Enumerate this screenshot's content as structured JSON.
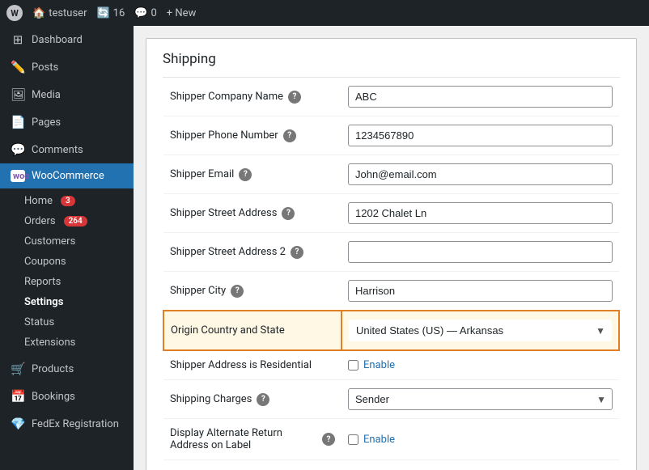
{
  "admin_bar": {
    "wp_logo": "W",
    "home_icon": "🏠",
    "username": "testuser",
    "updates_count": "16",
    "comments_count": "0",
    "new_label": "+ New"
  },
  "sidebar": {
    "dashboard_label": "Dashboard",
    "posts_label": "Posts",
    "media_label": "Media",
    "pages_label": "Pages",
    "comments_label": "Comments",
    "woocommerce_label": "WooCommerce",
    "home_label": "Home",
    "home_badge": "3",
    "orders_label": "Orders",
    "orders_badge": "264",
    "customers_label": "Customers",
    "coupons_label": "Coupons",
    "reports_label": "Reports",
    "settings_label": "Settings",
    "status_label": "Status",
    "extensions_label": "Extensions",
    "products_label": "Products",
    "bookings_label": "Bookings",
    "fedex_label": "FedEx Registration"
  },
  "content": {
    "page_title": "Shipping",
    "fields": [
      {
        "label": "Shipper Company Name",
        "type": "text",
        "value": "ABC",
        "has_help": true
      },
      {
        "label": "Shipper Phone Number",
        "type": "text",
        "value": "1234567890",
        "has_help": true
      },
      {
        "label": "Shipper Email",
        "type": "text",
        "value": "John@email.com",
        "has_help": true
      },
      {
        "label": "Shipper Street Address",
        "type": "text",
        "value": "1202 Chalet Ln",
        "has_help": true
      },
      {
        "label": "Shipper Street Address 2",
        "type": "text",
        "value": "",
        "has_help": true
      },
      {
        "label": "Shipper City",
        "type": "text",
        "value": "Harrison",
        "has_help": true
      },
      {
        "label": "Origin Country and State",
        "type": "select",
        "value": "United States (US) — Arkansas",
        "highlighted": true,
        "has_help": false
      },
      {
        "label": "Shipper Address is Residential",
        "type": "checkbox",
        "checkbox_label": "Enable",
        "has_help": false
      },
      {
        "label": "Shipping Charges",
        "type": "select",
        "value": "Sender",
        "highlighted": false,
        "has_help": true
      },
      {
        "label": "Display Alternate Return Address on Label",
        "type": "checkbox",
        "checkbox_label": "Enable",
        "has_help": true
      }
    ]
  }
}
